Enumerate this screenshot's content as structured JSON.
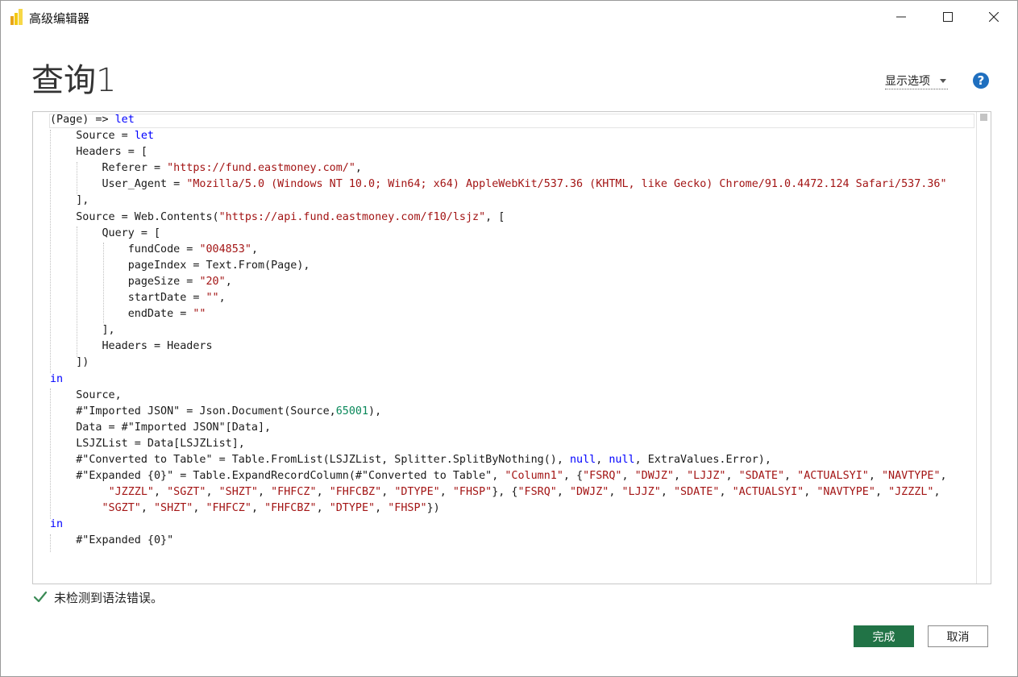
{
  "window": {
    "title": "高级编辑器"
  },
  "query": {
    "title": "查询1"
  },
  "toolbar": {
    "display_options_label": "显示选项",
    "help_icon": "help-icon",
    "help_symbol": "?"
  },
  "editor": {
    "lines": [
      [
        [
          "(Page) => ",
          ""
        ],
        [
          "let",
          "kw"
        ]
      ],
      [
        [
          "    Source = ",
          ""
        ],
        [
          "let",
          "kw"
        ]
      ],
      [
        [
          "    Headers = [",
          ""
        ]
      ],
      [
        [
          "        Referer = ",
          ""
        ],
        [
          "\"https://fund.eastmoney.com/\"",
          "st"
        ],
        [
          ",",
          ""
        ]
      ],
      [
        [
          "        User_Agent = ",
          ""
        ],
        [
          "\"Mozilla/5.0 (Windows NT 10.0; Win64; x64) AppleWebKit/537.36 (KHTML, like Gecko) Chrome/91.0.4472.124 Safari/537.36\"",
          "st"
        ]
      ],
      [
        [
          "    ],",
          ""
        ]
      ],
      [
        [
          "    Source = Web.Contents(",
          ""
        ],
        [
          "\"https://api.fund.eastmoney.com/f10/lsjz\"",
          "st"
        ],
        [
          ", [",
          ""
        ]
      ],
      [
        [
          "        Query = [",
          ""
        ]
      ],
      [
        [
          "            fundCode = ",
          ""
        ],
        [
          "\"004853\"",
          "st"
        ],
        [
          ",",
          ""
        ]
      ],
      [
        [
          "            pageIndex = Text.From(Page),",
          ""
        ]
      ],
      [
        [
          "            pageSize = ",
          ""
        ],
        [
          "\"20\"",
          "st"
        ],
        [
          ",",
          ""
        ]
      ],
      [
        [
          "            startDate = ",
          ""
        ],
        [
          "\"\"",
          "st"
        ],
        [
          ",",
          ""
        ]
      ],
      [
        [
          "            endDate = ",
          ""
        ],
        [
          "\"\"",
          "st"
        ]
      ],
      [
        [
          "        ],",
          ""
        ]
      ],
      [
        [
          "        Headers = Headers",
          ""
        ]
      ],
      [
        [
          "    ])",
          ""
        ]
      ],
      [
        [
          "in",
          "kw"
        ]
      ],
      [
        [
          "    Source,",
          ""
        ]
      ],
      [
        [
          "    #\"Imported JSON\" = Json.Document(Source,",
          ""
        ],
        [
          "65001",
          "nm"
        ],
        [
          "),",
          ""
        ]
      ],
      [
        [
          "    Data = #\"Imported JSON\"[Data],",
          ""
        ]
      ],
      [
        [
          "    LSJZList = Data[LSJZList],",
          ""
        ]
      ],
      [
        [
          "    #\"Converted to Table\" = Table.FromList(LSJZList, Splitter.SplitByNothing(), ",
          ""
        ],
        [
          "null",
          "kw"
        ],
        [
          ", ",
          ""
        ],
        [
          "null",
          "kw"
        ],
        [
          ", ExtraValues.Error),",
          ""
        ]
      ],
      [
        [
          "    #\"Expanded {0}\" = Table.ExpandRecordColumn(#\"Converted to Table\", ",
          ""
        ],
        [
          "\"Column1\"",
          "st"
        ],
        [
          ", {",
          ""
        ],
        [
          "\"FSRQ\"",
          "st"
        ],
        [
          ", ",
          ""
        ],
        [
          "\"DWJZ\"",
          "st"
        ],
        [
          ", ",
          ""
        ],
        [
          "\"LJJZ\"",
          "st"
        ],
        [
          ", ",
          ""
        ],
        [
          "\"SDATE\"",
          "st"
        ],
        [
          ", ",
          ""
        ],
        [
          "\"ACTUALSYI\"",
          "st"
        ],
        [
          ", ",
          ""
        ],
        [
          "\"NAVTYPE\"",
          "st"
        ],
        [
          ",",
          ""
        ]
      ],
      [
        [
          "         ",
          ""
        ],
        [
          "\"JZZZL\"",
          "st"
        ],
        [
          ", ",
          ""
        ],
        [
          "\"SGZT\"",
          "st"
        ],
        [
          ", ",
          ""
        ],
        [
          "\"SHZT\"",
          "st"
        ],
        [
          ", ",
          ""
        ],
        [
          "\"FHFCZ\"",
          "st"
        ],
        [
          ", ",
          ""
        ],
        [
          "\"FHFCBZ\"",
          "st"
        ],
        [
          ", ",
          ""
        ],
        [
          "\"DTYPE\"",
          "st"
        ],
        [
          ", ",
          ""
        ],
        [
          "\"FHSP\"",
          "st"
        ],
        [
          "}, {",
          ""
        ],
        [
          "\"FSRQ\"",
          "st"
        ],
        [
          ", ",
          ""
        ],
        [
          "\"DWJZ\"",
          "st"
        ],
        [
          ", ",
          ""
        ],
        [
          "\"LJJZ\"",
          "st"
        ],
        [
          ", ",
          ""
        ],
        [
          "\"SDATE\"",
          "st"
        ],
        [
          ", ",
          ""
        ],
        [
          "\"ACTUALSYI\"",
          "st"
        ],
        [
          ", ",
          ""
        ],
        [
          "\"NAVTYPE\"",
          "st"
        ],
        [
          ", ",
          ""
        ],
        [
          "\"JZZZL\"",
          "st"
        ],
        [
          ",",
          ""
        ]
      ],
      [
        [
          "        ",
          ""
        ],
        [
          "\"SGZT\"",
          "st"
        ],
        [
          ", ",
          ""
        ],
        [
          "\"SHZT\"",
          "st"
        ],
        [
          ", ",
          ""
        ],
        [
          "\"FHFCZ\"",
          "st"
        ],
        [
          ", ",
          ""
        ],
        [
          "\"FHFCBZ\"",
          "st"
        ],
        [
          ", ",
          ""
        ],
        [
          "\"DTYPE\"",
          "st"
        ],
        [
          ", ",
          ""
        ],
        [
          "\"FHSP\"",
          "st"
        ],
        [
          "})",
          ""
        ]
      ],
      [
        [
          "in",
          "kw"
        ]
      ],
      [
        [
          "    #\"Expanded {0}\"",
          ""
        ]
      ]
    ]
  },
  "status": {
    "message": "未检测到语法错误。"
  },
  "buttons": {
    "done_label": "完成",
    "cancel_label": "取消"
  },
  "colors": {
    "keyword": "#0000ff",
    "string": "#a31515",
    "number": "#09885a",
    "primary_button": "#217346",
    "help": "#1f6fbf",
    "check": "#3a8a55"
  }
}
